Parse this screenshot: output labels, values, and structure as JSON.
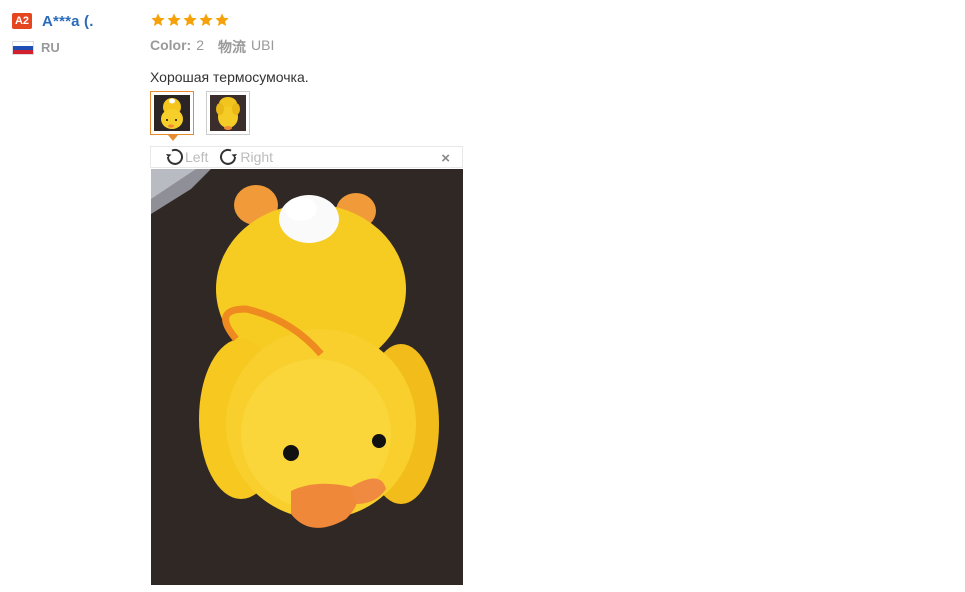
{
  "user": {
    "level_badge": "A2",
    "name": "A***a (.",
    "country": "RU",
    "flag_colors": [
      "#ffffff",
      "#1f4fb5",
      "#d3202f"
    ]
  },
  "review": {
    "rating": 5,
    "star_color": "#f5a20a",
    "color_label": "Color:",
    "color_value": "2",
    "shipping_label": "物流",
    "shipping_value": "UBI",
    "text": "Хорошая термосумочка."
  },
  "thumbnails": [
    {
      "name": "thumbnail-1",
      "active": true
    },
    {
      "name": "thumbnail-2",
      "active": false
    }
  ],
  "viewer": {
    "rotate_left_label": "Left",
    "rotate_right_label": "Right",
    "close_symbol": "×",
    "icons": [
      "rotate-left-icon",
      "rotate-right-icon",
      "close-icon"
    ]
  }
}
